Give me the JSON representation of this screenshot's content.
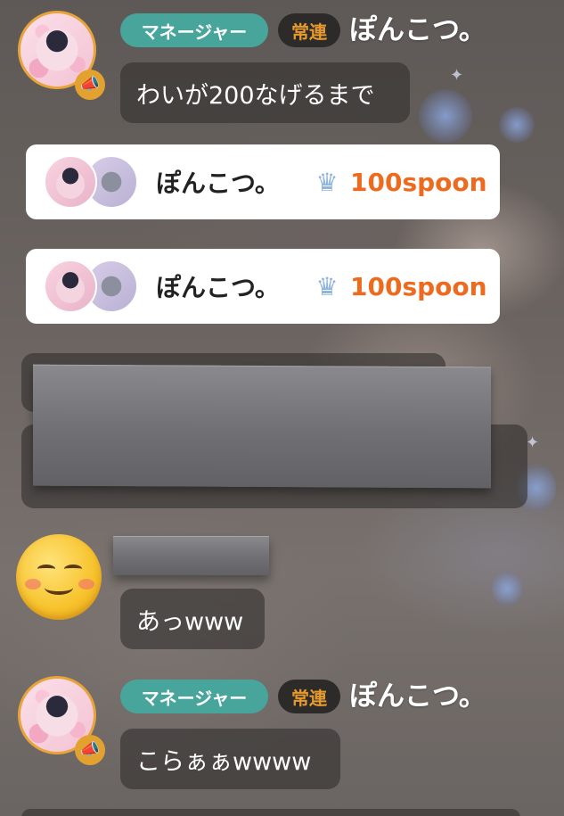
{
  "messages": [
    {
      "badges": {
        "manager": "マネージャー",
        "regular": "常連"
      },
      "username": "ぽんこつ。",
      "text": "わいが200なげるまで"
    },
    {
      "badges": {
        "manager": "マネージャー",
        "regular": "常連"
      },
      "username": "ぽんこつ。",
      "text": "こらぁぁwwww"
    }
  ],
  "gifts": [
    {
      "username": "ぽんこつ。",
      "amount": "100spoon",
      "icon": "crown-icon"
    },
    {
      "username": "ぽんこつ。",
      "amount": "100spoon",
      "icon": "crown-icon"
    }
  ],
  "emoji_message": {
    "text": "あっwww"
  },
  "colors": {
    "manager_badge": "#47a59c",
    "regular_badge_text": "#e69a2d",
    "spoon_amount": "#ee6a1f",
    "avatar_ring": "#e8a43a"
  }
}
